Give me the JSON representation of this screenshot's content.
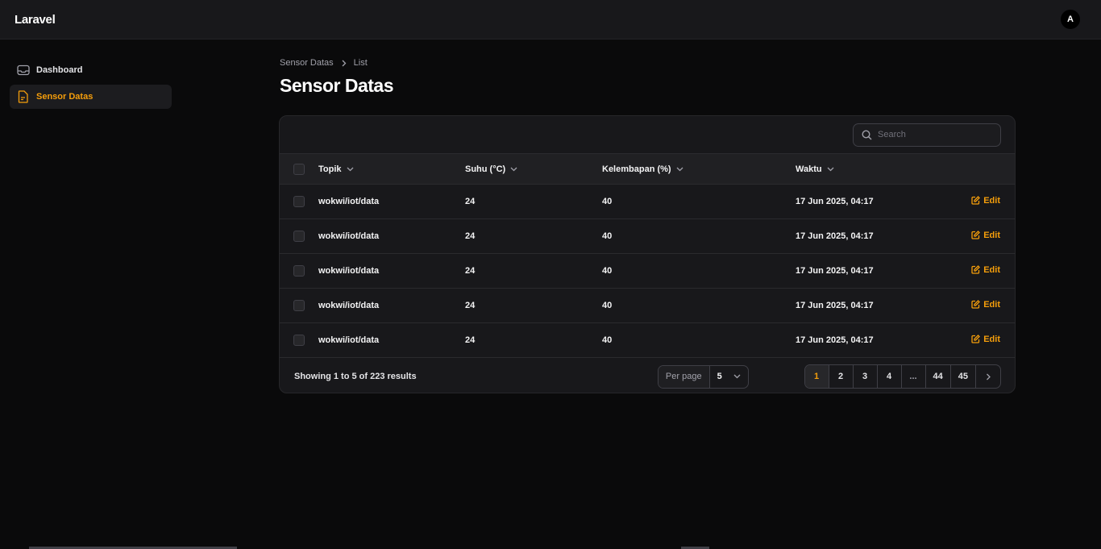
{
  "app": {
    "brand": "Laravel",
    "user_initial": "A"
  },
  "sidebar": {
    "items": [
      {
        "label": "Dashboard",
        "icon": "inbox-icon",
        "active": false
      },
      {
        "label": "Sensor Datas",
        "icon": "document-icon",
        "active": true
      }
    ]
  },
  "breadcrumb": {
    "root": "Sensor Datas",
    "current": "List"
  },
  "page": {
    "title": "Sensor Datas"
  },
  "table": {
    "search_placeholder": "Search",
    "columns": {
      "topik": "Topik",
      "suhu": "Suhu (°C)",
      "kelembapan": "Kelembapan (%)",
      "waktu": "Waktu"
    },
    "edit_label": "Edit",
    "rows": [
      {
        "topik": "wokwi/iot/data",
        "suhu": "24",
        "kelembapan": "40",
        "waktu": "17 Jun 2025, 04:17"
      },
      {
        "topik": "wokwi/iot/data",
        "suhu": "24",
        "kelembapan": "40",
        "waktu": "17 Jun 2025, 04:17"
      },
      {
        "topik": "wokwi/iot/data",
        "suhu": "24",
        "kelembapan": "40",
        "waktu": "17 Jun 2025, 04:17"
      },
      {
        "topik": "wokwi/iot/data",
        "suhu": "24",
        "kelembapan": "40",
        "waktu": "17 Jun 2025, 04:17"
      },
      {
        "topik": "wokwi/iot/data",
        "suhu": "24",
        "kelembapan": "40",
        "waktu": "17 Jun 2025, 04:17"
      }
    ]
  },
  "pagination": {
    "summary": "Showing 1 to 5 of 223 results",
    "per_page_label": "Per page",
    "per_page_value": "5",
    "pages": [
      "1",
      "2",
      "3",
      "4",
      "...",
      "44",
      "45"
    ],
    "current": "1"
  },
  "colors": {
    "accent": "#f59e0b",
    "background": "#0a0a0b",
    "surface": "#18181b"
  }
}
